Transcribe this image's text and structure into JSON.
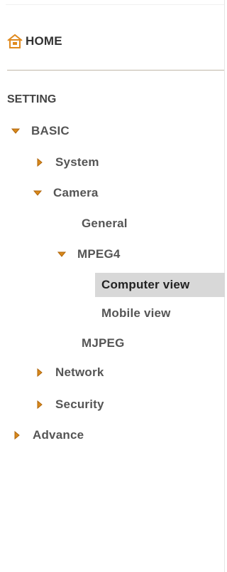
{
  "nav": {
    "home": {
      "label": "HOME",
      "icon": "home-icon"
    },
    "section_title": "SETTING",
    "items": {
      "basic": {
        "label": "BASIC",
        "expanded": true
      },
      "system": {
        "label": "System",
        "expanded": false
      },
      "camera": {
        "label": "Camera",
        "expanded": true
      },
      "general": {
        "label": "General"
      },
      "mpeg4": {
        "label": "MPEG4",
        "expanded": true
      },
      "computer_view": {
        "label": "Computer view",
        "selected": true
      },
      "mobile_view": {
        "label": "Mobile view"
      },
      "mjpeg": {
        "label": "MJPEG"
      },
      "network": {
        "label": "Network",
        "expanded": false
      },
      "security": {
        "label": "Security",
        "expanded": false
      },
      "advance": {
        "label": "Advance",
        "expanded": false
      }
    }
  },
  "colors": {
    "arrow_fill": "#d8891c",
    "arrow_stroke": "#b0650a",
    "home_icon": "#e08a1e",
    "selected_bg": "#d8d8d8",
    "text": "#555555",
    "divider": "#bfb7a8"
  }
}
